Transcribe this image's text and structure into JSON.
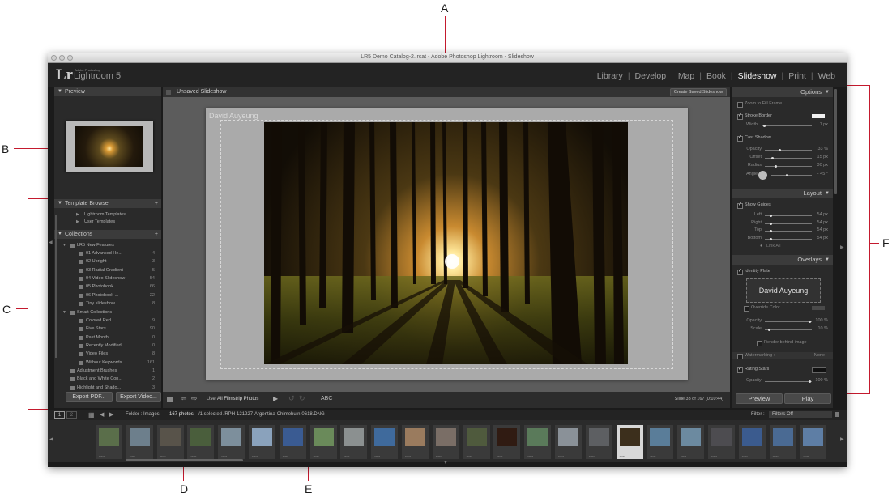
{
  "window": {
    "title": "LR5 Demo Catalog-2.lrcat - Adobe Photoshop Lightroom - Slideshow"
  },
  "identity_plate": {
    "logo": "Lr",
    "brand_small": "Adobe Photoshop",
    "product": "Lightroom 5"
  },
  "modules": [
    "Library",
    "Develop",
    "Map",
    "Book",
    "Slideshow",
    "Print",
    "Web"
  ],
  "active_module": "Slideshow",
  "left_panel": {
    "preview_title": "Preview",
    "template_browser_title": "Template Browser",
    "templates": [
      "Lightroom Templates",
      "User Templates"
    ],
    "collections_title": "Collections",
    "collection_set_1": "LR5 New Features",
    "collections": [
      {
        "name": "01 Advanced He...",
        "count": "4"
      },
      {
        "name": "02 Upright",
        "count": "3"
      },
      {
        "name": "03 Radial Gradient",
        "count": "5"
      },
      {
        "name": "04 Video Slideshow",
        "count": "54"
      },
      {
        "name": "05 Photobook ...",
        "count": "66"
      },
      {
        "name": "06 Photobook ...",
        "count": "22"
      },
      {
        "name": "Tiny slideshow",
        "count": "8"
      }
    ],
    "smart_collections_title": "Smart Collections",
    "smart_collections": [
      {
        "name": "Colored Red",
        "count": "9"
      },
      {
        "name": "Five Stars",
        "count": "90"
      },
      {
        "name": "Past Month",
        "count": "0"
      },
      {
        "name": "Recently Modified",
        "count": "0"
      },
      {
        "name": "Video Files",
        "count": "8"
      },
      {
        "name": "Without Keywords",
        "count": "161"
      }
    ],
    "other_collections": [
      {
        "name": "Adjustment Brushes",
        "count": "1"
      },
      {
        "name": "Black and White Con...",
        "count": "2"
      },
      {
        "name": "Highlight and Shado...",
        "count": "3"
      }
    ],
    "export_pdf": "Export PDF...",
    "export_video": "Export Video..."
  },
  "center": {
    "slideshow_name": "Unsaved Slideshow",
    "create_saved": "Create Saved Slideshow",
    "identity_text_on_slide": "David Auyeung",
    "use_label": "Use:",
    "use_value": "All Filmstrip Photos",
    "abc": "ABC",
    "slide_info": "Slide 33 of 167 (0:10:44)"
  },
  "right_panel": {
    "options_title": "Options",
    "zoom_to_fill": "Zoom to Fill Frame",
    "stroke_border": "Stroke Border",
    "width_label": "Width",
    "width_value": "1 px",
    "cast_shadow": "Cast Shadow",
    "shadow_rows": [
      {
        "label": "Opacity",
        "value": "33 %"
      },
      {
        "label": "Offset",
        "value": "15 px"
      },
      {
        "label": "Radius",
        "value": "30 px"
      }
    ],
    "angle_label": "Angle",
    "angle_value": "- 45 °",
    "layout_title": "Layout",
    "show_guides": "Show Guides",
    "guide_rows": [
      {
        "label": "Left",
        "value": "54 px"
      },
      {
        "label": "Right",
        "value": "54 px"
      },
      {
        "label": "Top",
        "value": "54 px"
      },
      {
        "label": "Bottom",
        "value": "54 px"
      }
    ],
    "link_all": "Link All",
    "overlays_title": "Overlays",
    "identity_plate_label": "Identity Plate",
    "identity_plate_text": "David Auyeung",
    "override_color": "Override Color",
    "overlay_rows": [
      {
        "label": "Opacity",
        "value": "100 %"
      },
      {
        "label": "Scale",
        "value": "10 %"
      }
    ],
    "render_behind": "Render behind image",
    "watermarking": "Watermarking :",
    "watermark_value": "None",
    "rating_stars": "Rating Stars",
    "rating_opacity_label": "Opacity",
    "rating_opacity_value": "100 %",
    "preview_button": "Preview",
    "play_button": "Play"
  },
  "filmstrip_bar": {
    "screen1": "1",
    "screen2": "2",
    "folder": "Folder : Images",
    "photo_count": "167 photos",
    "selection": "/1 selected /RPH-121227-Argentina-Chimehuin-0618.DNG",
    "filter_label": "Filter :",
    "filter_value": "Filters Off"
  },
  "filmstrip": {
    "stars": "•••••",
    "colors": [
      "#5a6e4a",
      "#6d7f8c",
      "#58534a",
      "#4a5e3c",
      "#7d8f9c",
      "#8aa2bc",
      "#3a5b92",
      "#6a8a5a",
      "#8b9090",
      "#3f6a9c",
      "#9a7b5e",
      "#7a6e66",
      "#4f5a3d",
      "#301b12",
      "#5a7a5a",
      "#8a9198",
      "#5d5f62",
      "#3c2f1c",
      "#5a7d99",
      "#6c8aa0",
      "#4d4c50",
      "#3b5b8e",
      "#4a6a93",
      "#5e7ea5"
    ]
  },
  "callouts": [
    "A",
    "B",
    "C",
    "D",
    "E",
    "F"
  ],
  "accent_color": "#c41a2e"
}
